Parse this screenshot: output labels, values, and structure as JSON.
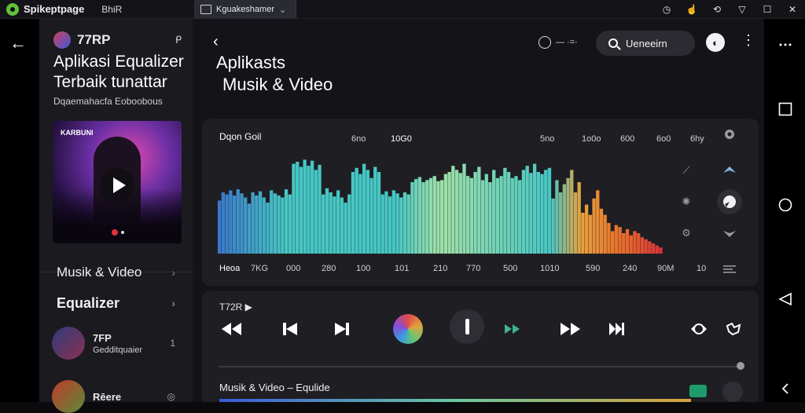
{
  "titlebar": {
    "app_name": "Spikeptpage",
    "menu": "BhiR",
    "tab_label": "Kguakeshamer",
    "tab_close": "⌄"
  },
  "sidebar": {
    "channel": "77RP",
    "title_line1": "Aplikasi Equalizer",
    "title_line2": "Terbaik tunattar",
    "subtitle": "Dqaemahacfa Eoboobous",
    "art_label": "KARBUNI",
    "nav": [
      {
        "label": "Musik & Video"
      },
      {
        "label": "Equalizer"
      }
    ],
    "items": [
      {
        "title": "7FP",
        "sub": "Gedditquaier",
        "side": "1"
      },
      {
        "title": "Rēere",
        "sub": "",
        "side": "◎"
      }
    ]
  },
  "header": {
    "title_line1": "Aplikasts",
    "title_line2": "Musik & Video",
    "chip_text": "— ·=·",
    "search_text": "Ueneeirn"
  },
  "equalizer": {
    "title": "Dqon Goil",
    "top_labels": [
      "6no",
      "10G0",
      "5no",
      "1o0o",
      "600",
      "6o0",
      "6hy"
    ],
    "bottom_label": "Heoa",
    "bottom_labels": [
      "7KG",
      "000",
      "280",
      "100",
      "101",
      "210",
      "770",
      "500",
      "1010",
      "590",
      "240",
      "90M",
      "10"
    ]
  },
  "chart_data": {
    "type": "bar",
    "x": [
      1,
      2,
      3,
      4,
      5,
      6,
      7,
      8,
      9,
      10,
      11,
      12,
      13,
      14,
      15,
      16,
      17,
      18,
      19,
      20,
      21,
      22,
      23,
      24,
      25,
      26,
      27,
      28,
      29,
      30,
      31,
      32,
      33,
      34,
      35,
      36,
      37,
      38,
      39,
      40,
      41,
      42,
      43,
      44,
      45,
      46,
      47,
      48,
      49,
      50,
      51,
      52,
      53,
      54,
      55,
      56,
      57,
      58,
      59,
      60,
      61,
      62,
      63,
      64,
      65,
      66,
      67,
      68,
      69,
      70,
      71,
      72,
      73,
      74,
      75,
      76,
      77,
      78,
      79,
      80,
      81,
      82,
      83,
      84,
      85,
      86,
      87,
      88,
      89,
      90,
      91,
      92,
      93,
      94,
      95,
      96,
      97,
      98,
      99,
      100,
      101,
      102,
      103,
      104,
      105,
      106,
      107,
      108,
      109,
      110,
      111,
      112,
      113,
      114,
      115,
      116,
      117,
      118,
      119,
      120
    ],
    "values": [
      52,
      60,
      58,
      62,
      57,
      63,
      59,
      55,
      49,
      60,
      57,
      61,
      55,
      50,
      62,
      59,
      57,
      55,
      63,
      58,
      88,
      90,
      85,
      92,
      86,
      91,
      82,
      87,
      58,
      64,
      60,
      56,
      62,
      55,
      50,
      58,
      80,
      84,
      78,
      88,
      82,
      74,
      85,
      80,
      58,
      61,
      56,
      62,
      59,
      55,
      60,
      58,
      70,
      73,
      75,
      70,
      72,
      74,
      76,
      71,
      72,
      78,
      80,
      86,
      82,
      79,
      88,
      76,
      74,
      80,
      85,
      72,
      78,
      70,
      82,
      74,
      76,
      84,
      80,
      74,
      76,
      72,
      82,
      86,
      79,
      88,
      80,
      78,
      82,
      84,
      54,
      72,
      60,
      68,
      74,
      82,
      60,
      70,
      40,
      48,
      38,
      54,
      62,
      44,
      38,
      30,
      22,
      28,
      26,
      20,
      24,
      18,
      22,
      20,
      16,
      14,
      12,
      10,
      8,
      6
    ],
    "ylim": [
      0,
      100
    ]
  },
  "player": {
    "label": "T72R ▶",
    "now_playing": "Musik & Video – Equlide"
  },
  "colors": {
    "accent": "#e03340",
    "eq_teal": "#46c7c4",
    "eq_mint": "#9fe0a8",
    "eq_blue": "#3b78c9",
    "eq_orange": "#e86a2a",
    "eq_red": "#d8343a"
  },
  "icons": [
    "back-arrow-icon",
    "pin-icon",
    "play-icon",
    "chevron-right-icon",
    "clock-icon",
    "search-icon",
    "more-icon",
    "rewind-icon",
    "previous-icon",
    "next-icon",
    "pause-icon",
    "forward-icon",
    "end-icon",
    "repeat-icon",
    "share-icon",
    "square-icon",
    "circle-icon",
    "triangle-icon"
  ]
}
